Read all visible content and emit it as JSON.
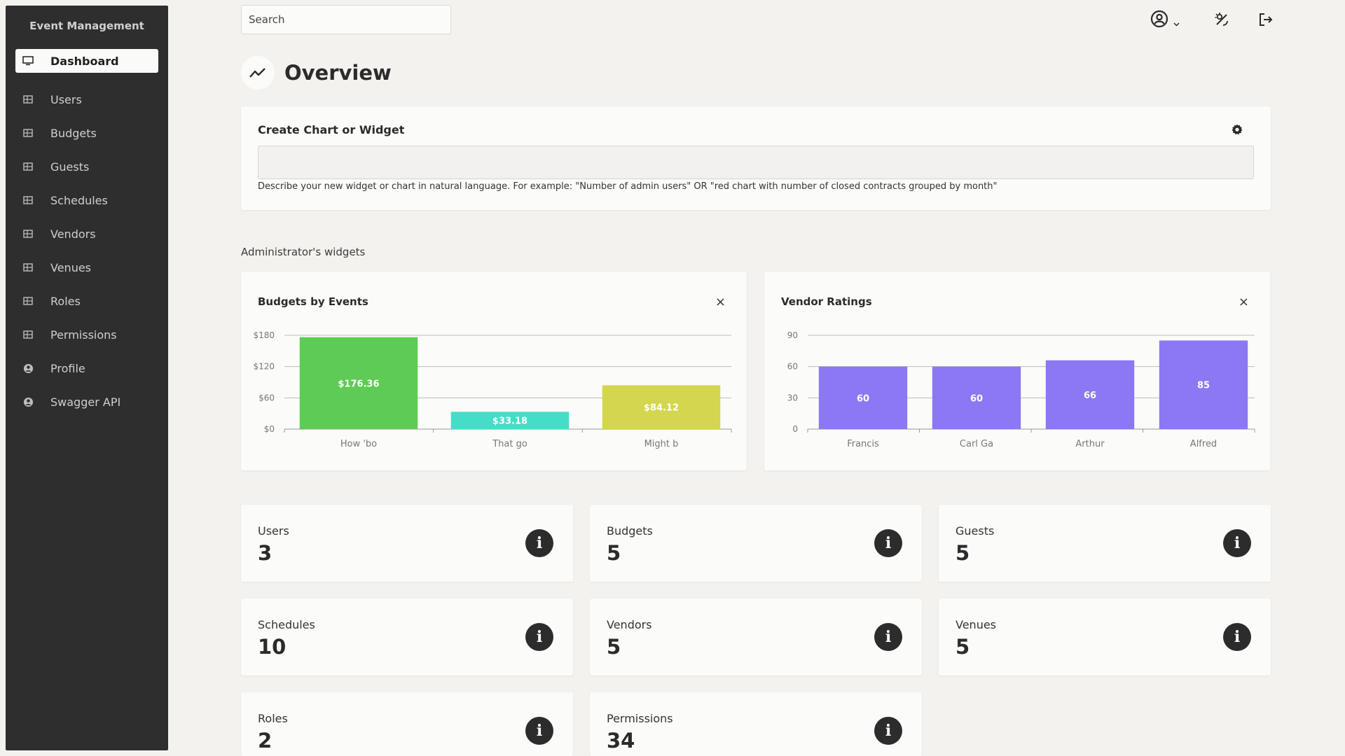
{
  "sidebar": {
    "title": "Event Management",
    "items": [
      {
        "label": "Dashboard",
        "icon": "monitor-icon",
        "active": true
      },
      {
        "label": "Users",
        "icon": "table-icon"
      },
      {
        "label": "Budgets",
        "icon": "table-icon"
      },
      {
        "label": "Guests",
        "icon": "table-icon"
      },
      {
        "label": "Schedules",
        "icon": "table-icon"
      },
      {
        "label": "Vendors",
        "icon": "table-icon"
      },
      {
        "label": "Venues",
        "icon": "table-icon"
      },
      {
        "label": "Roles",
        "icon": "table-icon"
      },
      {
        "label": "Permissions",
        "icon": "table-icon"
      },
      {
        "label": "Profile",
        "icon": "user-circle-icon"
      },
      {
        "label": "Swagger API",
        "icon": "user-circle-icon"
      }
    ]
  },
  "topbar": {
    "search_placeholder": "Search",
    "icons": [
      "user-account-icon",
      "chevron-down-icon",
      "theme-toggle-icon",
      "logout-icon"
    ]
  },
  "page": {
    "title": "Overview",
    "icon": "trend-line-icon"
  },
  "create_widget": {
    "title": "Create Chart or Widget",
    "input_value": "",
    "help": "Describe your new widget or chart in natural language. For example: \"Number of admin users\" OR \"red chart with number of closed contracts grouped by month\""
  },
  "widgets_label": "Administrator's widgets",
  "charts": [
    {
      "title": "Budgets by Events",
      "close": "×",
      "chart_data": {
        "type": "bar",
        "categories": [
          "How 'bo",
          "That go",
          "Might b"
        ],
        "values": [
          176.36,
          33.18,
          84.12
        ],
        "value_labels": [
          "$176.36",
          "$33.18",
          "$84.12"
        ],
        "colors": [
          "#5ecb55",
          "#45ddc8",
          "#d3d64e"
        ],
        "yticks": [
          "$0",
          "$60",
          "$120",
          "$180"
        ],
        "ylim": [
          0,
          180
        ],
        "grid": true
      }
    },
    {
      "title": "Vendor Ratings",
      "close": "×",
      "chart_data": {
        "type": "bar",
        "categories": [
          "Francis",
          "Carl Ga",
          "Arthur",
          "Alfred"
        ],
        "values": [
          60,
          60,
          66,
          85
        ],
        "value_labels": [
          "60",
          "60",
          "66",
          "85"
        ],
        "colors": [
          "#8b78f2",
          "#8b78f2",
          "#8b78f2",
          "#8b78f2"
        ],
        "yticks": [
          "0",
          "30",
          "60",
          "90"
        ],
        "ylim": [
          0,
          90
        ],
        "grid": true
      }
    }
  ],
  "stats": [
    {
      "label": "Users",
      "value": "3"
    },
    {
      "label": "Budgets",
      "value": "5"
    },
    {
      "label": "Guests",
      "value": "5"
    },
    {
      "label": "Schedules",
      "value": "10"
    },
    {
      "label": "Vendors",
      "value": "5"
    },
    {
      "label": "Venues",
      "value": "5"
    },
    {
      "label": "Roles",
      "value": "2"
    },
    {
      "label": "Permissions",
      "value": "34"
    }
  ],
  "info_glyph": "i"
}
